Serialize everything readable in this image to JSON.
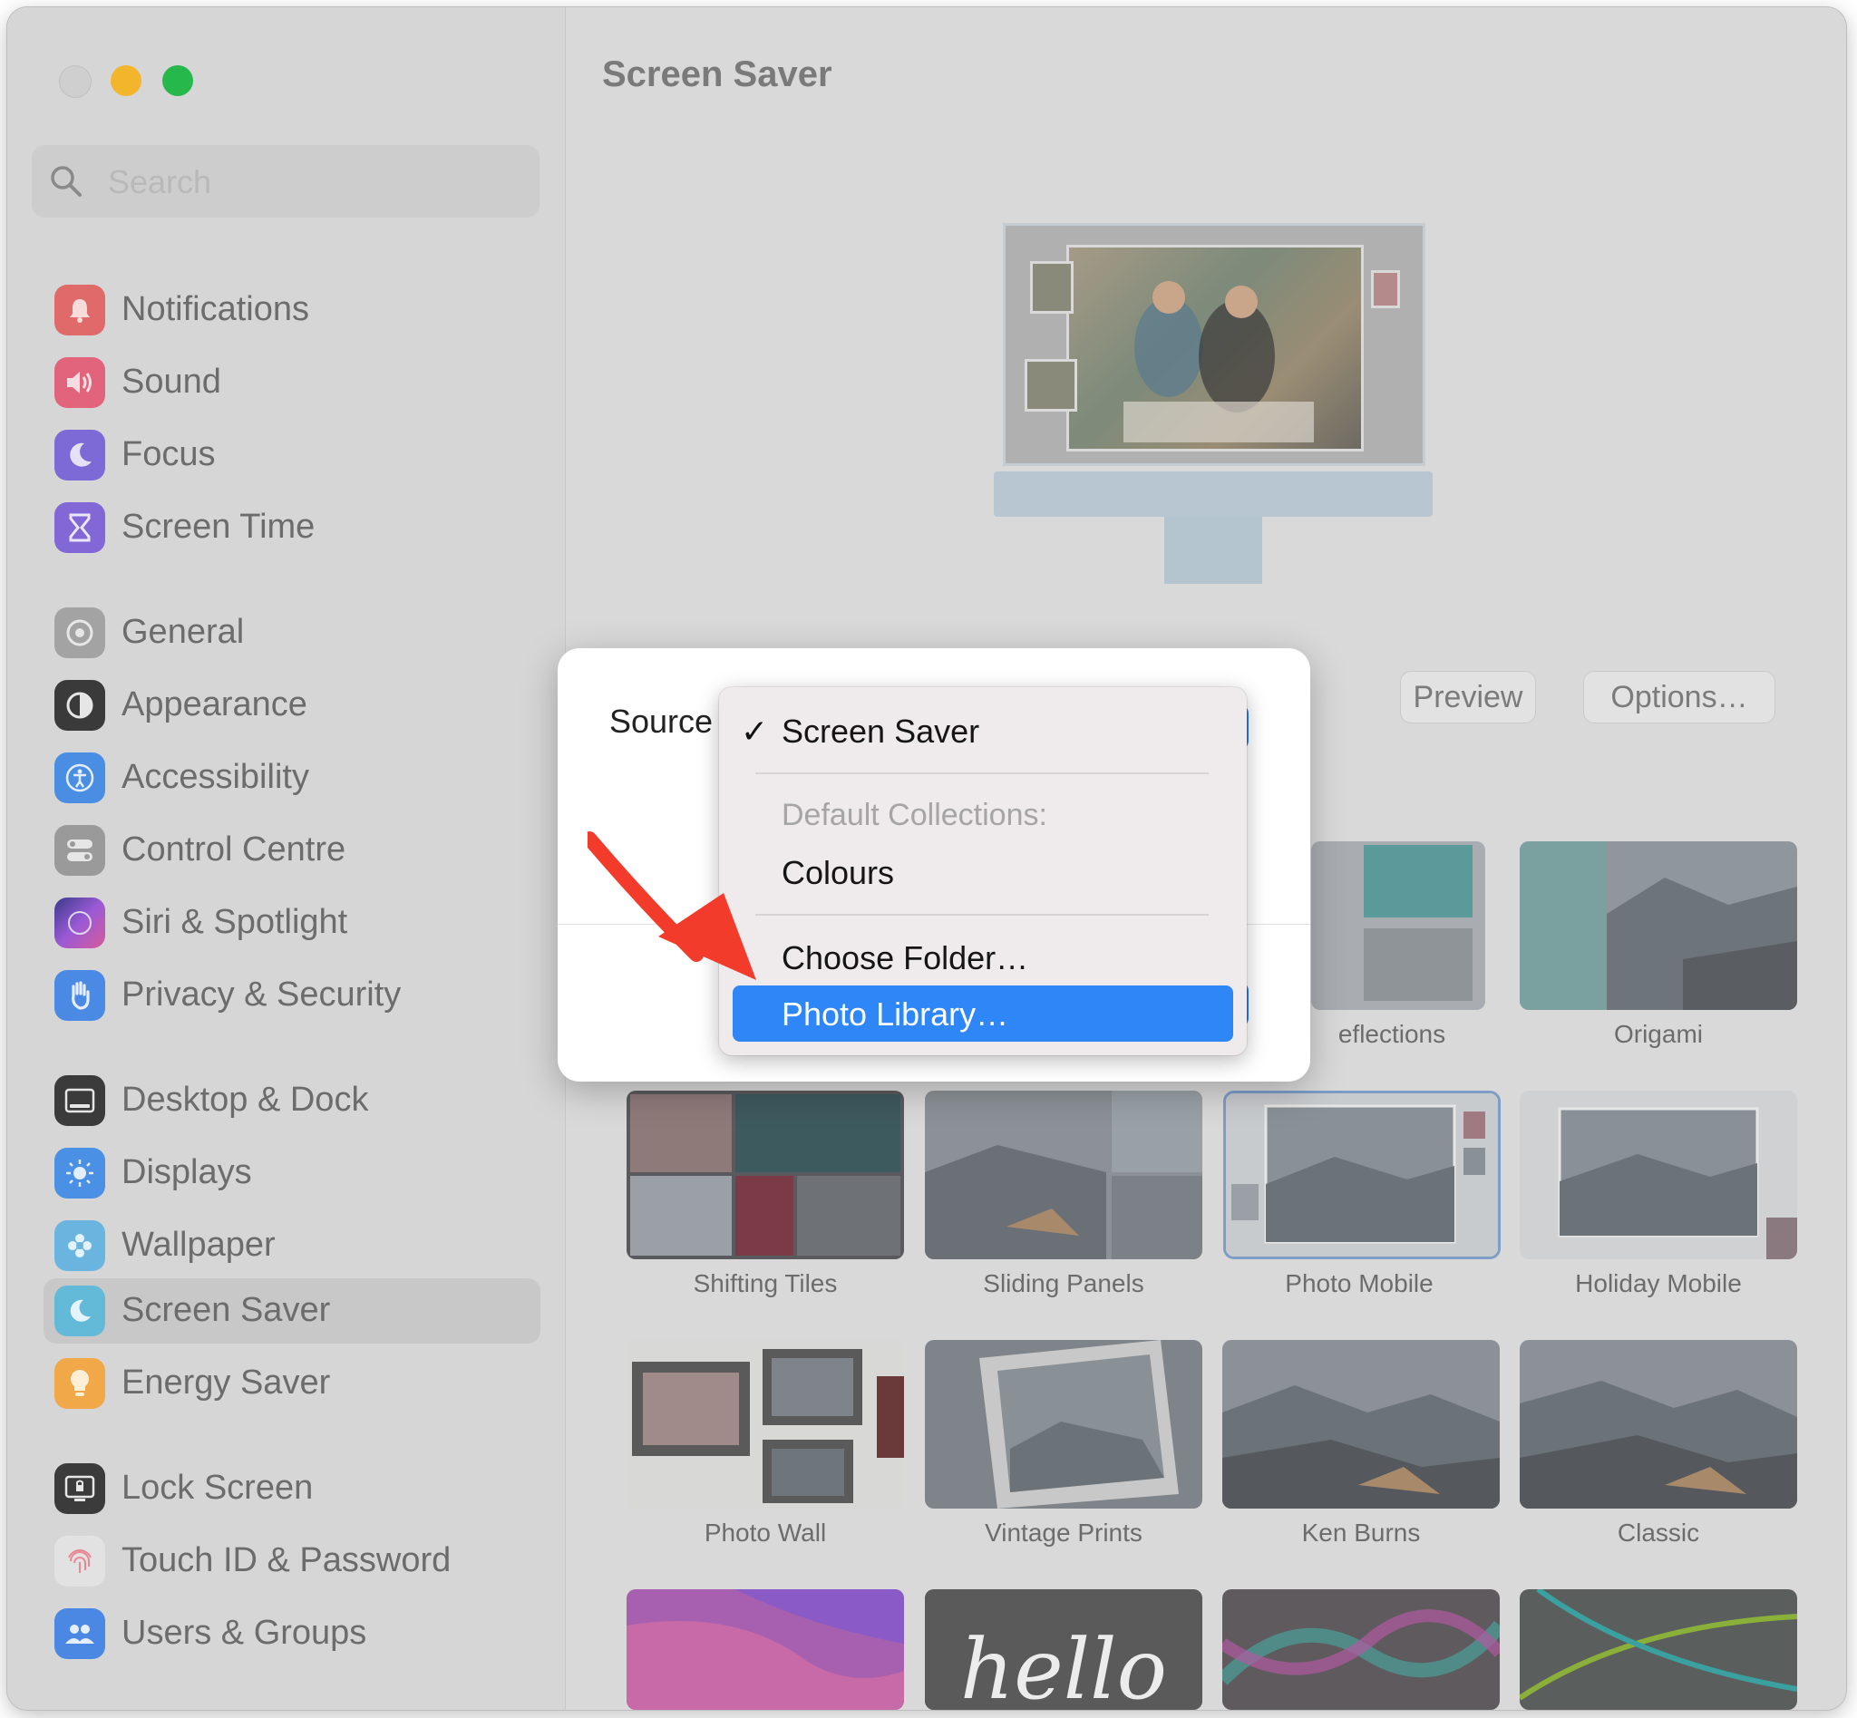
{
  "window": {
    "title": "Screen Saver",
    "search_placeholder": "Search"
  },
  "sidebar": {
    "items": [
      {
        "label": "Notifications",
        "icon": "bell-icon",
        "color": "#e35a5a"
      },
      {
        "label": "Sound",
        "icon": "speaker-icon",
        "color": "#e05a74"
      },
      {
        "label": "Focus",
        "icon": "moon-icon",
        "color": "#6e5fd0"
      },
      {
        "label": "Screen Time",
        "icon": "hourglass-icon",
        "color": "#7a5fd0"
      },
      {
        "label": "General",
        "icon": "gear-icon",
        "color": "#9a9a9a"
      },
      {
        "label": "Appearance",
        "icon": "appearance-icon",
        "color": "#2c2c2c"
      },
      {
        "label": "Accessibility",
        "icon": "accessibility-icon",
        "color": "#3a84e0"
      },
      {
        "label": "Control Centre",
        "icon": "toggles-icon",
        "color": "#8f8f8f"
      },
      {
        "label": "Siri & Spotlight",
        "icon": "siri-icon",
        "color": "#7a4fc6"
      },
      {
        "label": "Privacy & Security",
        "icon": "hand-icon",
        "color": "#3b82e6"
      },
      {
        "label": "Desktop & Dock",
        "icon": "dock-icon",
        "color": "#2a2a2a"
      },
      {
        "label": "Displays",
        "icon": "sun-icon",
        "color": "#3b8ae6"
      },
      {
        "label": "Wallpaper",
        "icon": "flower-icon",
        "color": "#5ab0e0"
      },
      {
        "label": "Screen Saver",
        "icon": "screensaver-icon",
        "color": "#5ab8d8"
      },
      {
        "label": "Energy Saver",
        "icon": "bulb-icon",
        "color": "#f2a43a"
      },
      {
        "label": "Lock Screen",
        "icon": "lock-screen-icon",
        "color": "#2a2a2a"
      },
      {
        "label": "Touch ID & Password",
        "icon": "fingerprint-icon",
        "color": "#e8e8e8"
      },
      {
        "label": "Users & Groups",
        "icon": "users-icon",
        "color": "#3b84e6"
      }
    ],
    "selected": "Screen Saver"
  },
  "main": {
    "preview_button": "Preview",
    "options_button": "Options…",
    "partial_label": "eflections",
    "thumbnails": [
      {
        "label": "Origami"
      },
      {
        "label": "Shifting Tiles"
      },
      {
        "label": "Sliding Panels"
      },
      {
        "label": "Photo Mobile"
      },
      {
        "label": "Holiday Mobile"
      },
      {
        "label": "Photo Wall"
      },
      {
        "label": "Vintage Prints"
      },
      {
        "label": "Ken Burns"
      },
      {
        "label": "Classic"
      },
      {
        "label": "hello"
      }
    ]
  },
  "dialog": {
    "source_label": "Source",
    "menu": {
      "selected": "Screen Saver",
      "section_header": "Default Collections:",
      "items": [
        "Colours",
        "Choose Folder…",
        "Photo Library…"
      ],
      "highlighted": "Photo Library…"
    }
  },
  "colors": {
    "accent": "#2f86f6",
    "arrow": "#f23b2a"
  }
}
